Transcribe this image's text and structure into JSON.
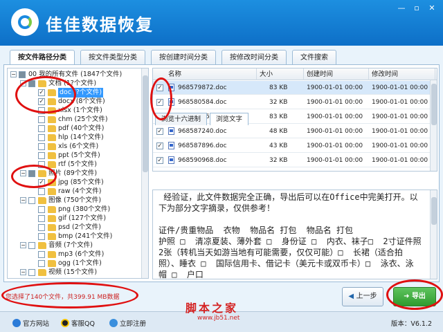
{
  "app": {
    "title": "佳佳数据恢复"
  },
  "window_controls": {
    "minimize": "—",
    "maximize": "▫",
    "close": "✕"
  },
  "tabs": [
    {
      "label": "按文件路径分类",
      "active": true
    },
    {
      "label": "按文件类型分类",
      "active": false
    },
    {
      "label": "按创建时间分类",
      "active": false
    },
    {
      "label": "按修改时间分类",
      "active": false
    },
    {
      "label": "文件搜索",
      "active": false
    }
  ],
  "tree": [
    {
      "label": "00 我的所有文件  (1847个文件)",
      "depth": 0,
      "checked": "partial",
      "expanded": true,
      "folder": false
    },
    {
      "label": "文档  (1?个文件)",
      "depth": 1,
      "checked": "partial",
      "expanded": true,
      "folder": true
    },
    {
      "label": "doc  (?个文件)",
      "depth": 2,
      "checked": "checked",
      "folder": true,
      "selected": true
    },
    {
      "label": "docx  (8个文件)",
      "depth": 2,
      "checked": "checked",
      "folder": true
    },
    {
      "label": "xlsx  (1个文件)",
      "depth": 2,
      "checked": "none",
      "folder": true
    },
    {
      "label": "chm  (25个文件)",
      "depth": 2,
      "checked": "none",
      "folder": true
    },
    {
      "label": "pdf  (40个文件)",
      "depth": 2,
      "checked": "none",
      "folder": true
    },
    {
      "label": "hlp  (14个文件)",
      "depth": 2,
      "checked": "none",
      "folder": true
    },
    {
      "label": "xls  (6个文件)",
      "depth": 2,
      "checked": "none",
      "folder": true
    },
    {
      "label": "ppt  (5个文件)",
      "depth": 2,
      "checked": "none",
      "folder": true
    },
    {
      "label": "rtf  (5个文件)",
      "depth": 2,
      "checked": "none",
      "folder": true
    },
    {
      "label": "照片  (89个文件)",
      "depth": 1,
      "checked": "partial",
      "expanded": true,
      "folder": true
    },
    {
      "label": "jpg  (85个文件)",
      "depth": 2,
      "checked": "checked",
      "folder": true
    },
    {
      "label": "raw  (4个文件)",
      "depth": 2,
      "checked": "none",
      "folder": true
    },
    {
      "label": "图像  (750个文件)",
      "depth": 1,
      "checked": "none",
      "expanded": true,
      "folder": true
    },
    {
      "label": "png  (380个文件)",
      "depth": 2,
      "checked": "none",
      "folder": true
    },
    {
      "label": "gif  (127个文件)",
      "depth": 2,
      "checked": "none",
      "folder": true
    },
    {
      "label": "psd  (2个文件)",
      "depth": 2,
      "checked": "none",
      "folder": true
    },
    {
      "label": "bmp  (241个文件)",
      "depth": 2,
      "checked": "none",
      "folder": true
    },
    {
      "label": "音频  (7个文件)",
      "depth": 1,
      "checked": "none",
      "expanded": true,
      "folder": true
    },
    {
      "label": "mp3  (6个文件)",
      "depth": 2,
      "checked": "none",
      "folder": true
    },
    {
      "label": "ogg  (1个文件)",
      "depth": 2,
      "checked": "none",
      "folder": true
    },
    {
      "label": "视频  (15个文件)",
      "depth": 1,
      "checked": "none",
      "expanded": true,
      "folder": true
    }
  ],
  "file_list": {
    "columns": [
      "名称",
      "大小",
      "创建时间",
      "修改时间"
    ],
    "rows": [
      {
        "name": "968579872.doc",
        "size": "83 KB",
        "created": "1900-01-01 00:00",
        "modified": "1900-01-01 00:00",
        "checked": true,
        "selected": true
      },
      {
        "name": "968580584.doc",
        "size": "32 KB",
        "created": "1900-01-01 00:00",
        "modified": "1900-01-01 00:00",
        "checked": true,
        "selected": false
      },
      {
        "name": "968580656.doc",
        "size": "83 KB",
        "created": "1900-01-01 00:00",
        "modified": "1900-01-01 00:00",
        "checked": true,
        "selected": false
      },
      {
        "name": "968587240.doc",
        "size": "48 KB",
        "created": "1900-01-01 00:00",
        "modified": "1900-01-01 00:00",
        "checked": true,
        "selected": false
      },
      {
        "name": "968587896.doc",
        "size": "43 KB",
        "created": "1900-01-01 00:00",
        "modified": "1900-01-01 00:00",
        "checked": true,
        "selected": false
      },
      {
        "name": "968590968.doc",
        "size": "32 KB",
        "created": "1900-01-01 00:00",
        "modified": "1900-01-01 00:00",
        "checked": true,
        "selected": false
      }
    ]
  },
  "preview_tabs": [
    {
      "label": "浏览十六进制",
      "active": false
    },
    {
      "label": "浏览文字",
      "active": true
    }
  ],
  "preview_text": " 经验证，此文件数据完全正确，导出后可以在Office中完美打开。以下为部分文字摘录，仅供参考！\n\n证件/贵重物品  衣物  物品名 打包  物品名 打包\n护照 □  清凉夏装、薄外套 □  身份证 □  内衣、袜子□  2寸证件照2张（转机当天如游当地有可能需要，仅仅可能）□  长裙（适合拍照）、睡衣 □  国际信用卡、借记卡（美元卡或双币卡）□  泳衣、泳帽 □  户口",
  "status": {
    "selection_text": "您选择了140个文件，共399.91 MB数据"
  },
  "buttons": {
    "prev": "上一步",
    "export": "导出"
  },
  "footer": {
    "website": "官方网站",
    "qq": "客服QQ",
    "register": "立即注册",
    "watermark": "脚本之家",
    "watermark_sub": "www.jb51.net",
    "version_label": "版本：",
    "version": "V6.1.2"
  }
}
